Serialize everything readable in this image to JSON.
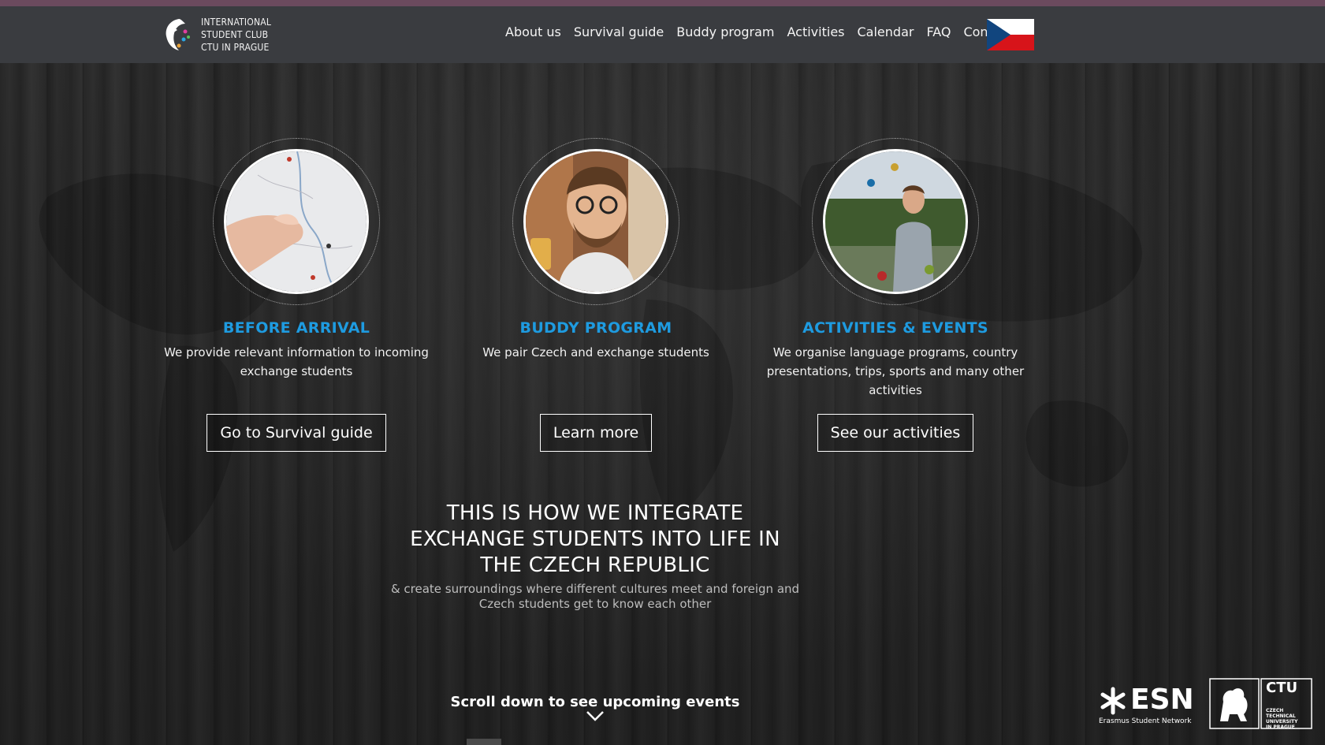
{
  "header": {
    "logo_text": [
      "INTERNATIONAL",
      "STUDENT CLUB",
      "CTU IN PRAGUE"
    ],
    "nav": [
      {
        "label": "About us"
      },
      {
        "label": "Survival guide"
      },
      {
        "label": "Buddy program"
      },
      {
        "label": "Activities"
      },
      {
        "label": "Calendar"
      },
      {
        "label": "FAQ"
      },
      {
        "label": "Contacts"
      }
    ],
    "flag_icon": "czech-flag-icon"
  },
  "features": [
    {
      "title": "BEFORE ARRIVAL",
      "description": "We provide relevant information to incoming exchange students",
      "button": "Go to Survival guide",
      "image": "map-of-czech-republic-photo"
    },
    {
      "title": "BUDDY PROGRAM",
      "description": "We pair Czech and exchange students",
      "button": "Learn more",
      "image": "smiling-student-portrait-photo"
    },
    {
      "title": "ACTIVITIES & EVENTS",
      "description": "We organise language programs, country presentations, trips, sports and many other activities",
      "button": "See our activities",
      "image": "juggling-student-photo"
    }
  ],
  "headline": {
    "title": "THIS IS HOW WE INTEGRATE EXCHANGE STUDENTS INTO LIFE IN THE CZECH REPUBLIC",
    "subtitle": "& create surroundings where different cultures meet and foreign and Czech students get to know each other"
  },
  "scroll_cta": "Scroll down to see upcoming events",
  "partners": {
    "esn_name": "ESN",
    "esn_caption": "Erasmus Student Network",
    "ctu_name": "CTU",
    "ctu_caption": [
      "CZECH TECHNICAL",
      "UNIVERSITY",
      "IN PRAGUE"
    ]
  },
  "colors": {
    "accent": "#1e9be0",
    "navbar": "#3a3c40",
    "top_line": "#6b4a5e"
  }
}
